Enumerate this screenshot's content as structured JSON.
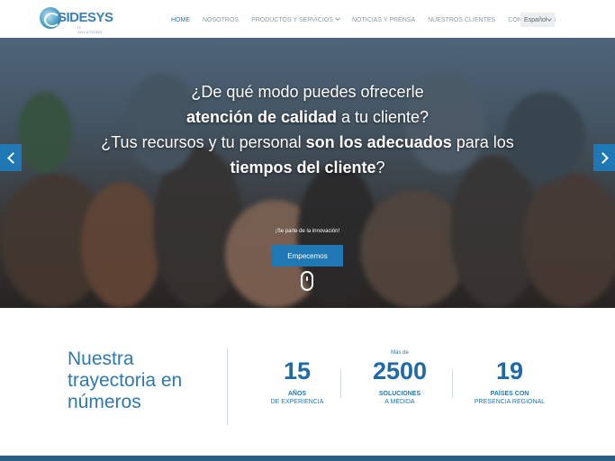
{
  "header": {
    "logo_text": "SIDESYS",
    "logo_sub": "IT SOLUTIONS",
    "nav": [
      {
        "label": "Home",
        "active": true
      },
      {
        "label": "Nosotros",
        "active": false
      },
      {
        "label": "Productos y Servicios",
        "active": false,
        "has_dropdown": true
      },
      {
        "label": "Noticias y Prensa",
        "active": false
      },
      {
        "label": "Nuestros Clientes",
        "active": false
      },
      {
        "label": "Contáctanos",
        "active": false
      }
    ],
    "language": "Español"
  },
  "hero": {
    "line1": "¿De qué modo puedes ofrecerle",
    "line2_bold": "atención de calidad",
    "line2_rest": " a tu cliente?",
    "line3_start": "¿Tus recursos y tu personal ",
    "line3_bold": "son los adecuados",
    "line3_end": " para los",
    "line4_bold": "tiempos del cliente",
    "line4_end": "?",
    "tagline": "¡Se parte de la innovación!",
    "cta_label": "Empecemos"
  },
  "stats": {
    "title": "Nuestra trayectoria en números",
    "items": [
      {
        "pre": "",
        "number": "15",
        "label": "Años",
        "sub": "de experiencia"
      },
      {
        "pre": "Más de",
        "number": "2500",
        "label": "Soluciones",
        "sub": "a medida"
      },
      {
        "pre": "",
        "number": "19",
        "label": "Países con",
        "sub": "presencia regional"
      }
    ]
  },
  "colors": {
    "accent": "#1f78b4",
    "number": "#1f6aa6",
    "footer": "#2b5f86"
  }
}
